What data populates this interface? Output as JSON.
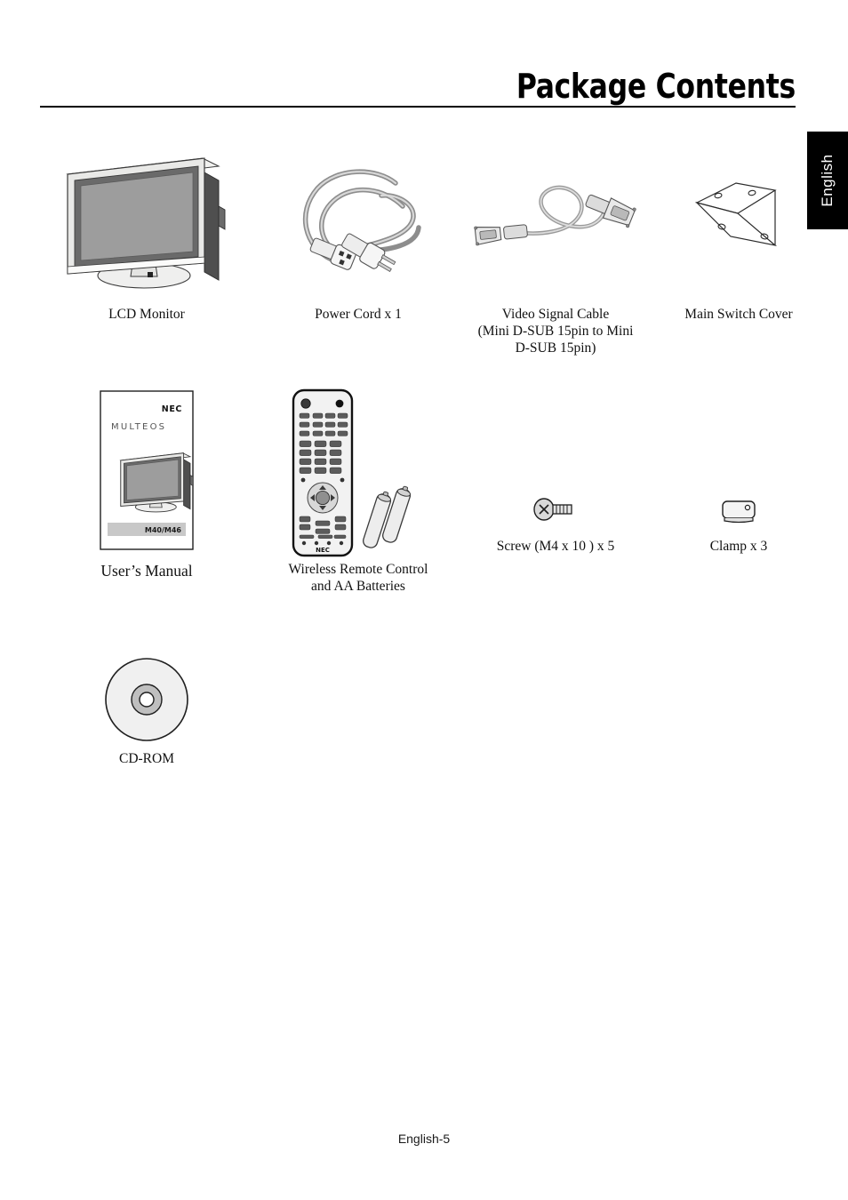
{
  "page": {
    "title": "Package Contents",
    "language_tab": "English",
    "footer": "English-5",
    "background_color": "#ffffff",
    "rule_color": "#000000"
  },
  "items": [
    {
      "id": "lcd-monitor",
      "icon": "lcd-monitor-illustration",
      "caption_lines": [
        "LCD Monitor"
      ],
      "emphasis": false
    },
    {
      "id": "power-cord",
      "icon": "power-cord-illustration",
      "caption_lines": [
        "Power Cord x 1"
      ],
      "emphasis": false
    },
    {
      "id": "video-signal-cable",
      "icon": "video-signal-cable-illustration",
      "caption_lines": [
        "Video Signal Cable",
        "(Mini D-SUB 15pin to Mini",
        "D-SUB 15pin)"
      ],
      "emphasis": false
    },
    {
      "id": "main-switch-cover",
      "icon": "main-switch-cover-illustration",
      "caption_lines": [
        "Main Switch Cover"
      ],
      "emphasis": false
    },
    {
      "id": "users-manual",
      "icon": "users-manual-illustration",
      "caption_lines": [
        "User’s Manual"
      ],
      "emphasis": true
    },
    {
      "id": "wireless-remote-control",
      "icon": "remote-control-illustration",
      "caption_lines": [
        "Wireless Remote Control",
        "and AA Batteries"
      ],
      "emphasis": false
    },
    {
      "id": "screw",
      "icon": "screw-illustration",
      "caption_lines": [
        "Screw (M4 x 10 ) x 5"
      ],
      "emphasis": false
    },
    {
      "id": "clamp",
      "icon": "clamp-illustration",
      "caption_lines": [
        "Clamp x 3"
      ],
      "emphasis": false
    },
    {
      "id": "cd-rom",
      "icon": "cd-rom-illustration",
      "caption_lines": [
        "CD-ROM"
      ],
      "emphasis": false
    }
  ],
  "manual_cover": {
    "brand": "NEC",
    "product_line": "MULTEOS",
    "model": "M40/M46"
  },
  "remote": {
    "brand": "NEC"
  },
  "colors": {
    "screen_gray": "#9d9d9d",
    "bezel_light": "#e8e8e6",
    "frame_dark": "#4a4a4a",
    "cable_gray": "#c9c9c9",
    "line": "#3a3a3a"
  }
}
